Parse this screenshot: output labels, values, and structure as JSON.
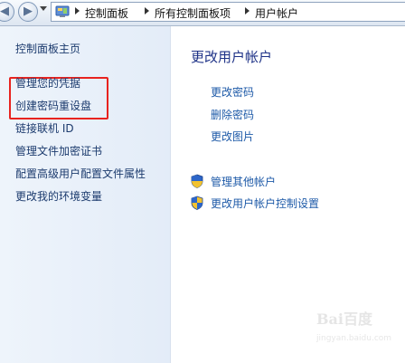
{
  "breadcrumb": {
    "items": [
      "控制面板",
      "所有控制面板项",
      "用户帐户"
    ]
  },
  "sidebar": {
    "home_label": "控制面板主页",
    "items": [
      {
        "label": "管理您的凭据"
      },
      {
        "label": "创建密码重设盘"
      },
      {
        "label": "链接联机 ID"
      },
      {
        "label": "管理文件加密证书"
      },
      {
        "label": "配置高级用户配置文件属性"
      },
      {
        "label": "更改我的环境变量"
      }
    ]
  },
  "main": {
    "title": "更改用户帐户",
    "links": [
      {
        "label": "更改密码"
      },
      {
        "label": "删除密码"
      },
      {
        "label": "更改图片"
      }
    ],
    "admin_links": [
      {
        "label": "管理其他帐户",
        "icon": "uac-shield-icon"
      },
      {
        "label": "更改用户帐户控制设置",
        "icon": "uac-shield-icon"
      }
    ]
  },
  "watermark": {
    "text": "Bai百度",
    "sub": "jingyan.baidu.com"
  },
  "colors": {
    "highlight": "#e8231f",
    "link": "#1e5aa8",
    "title": "#1e3287",
    "sidebar_bg": "#e6eef9"
  }
}
